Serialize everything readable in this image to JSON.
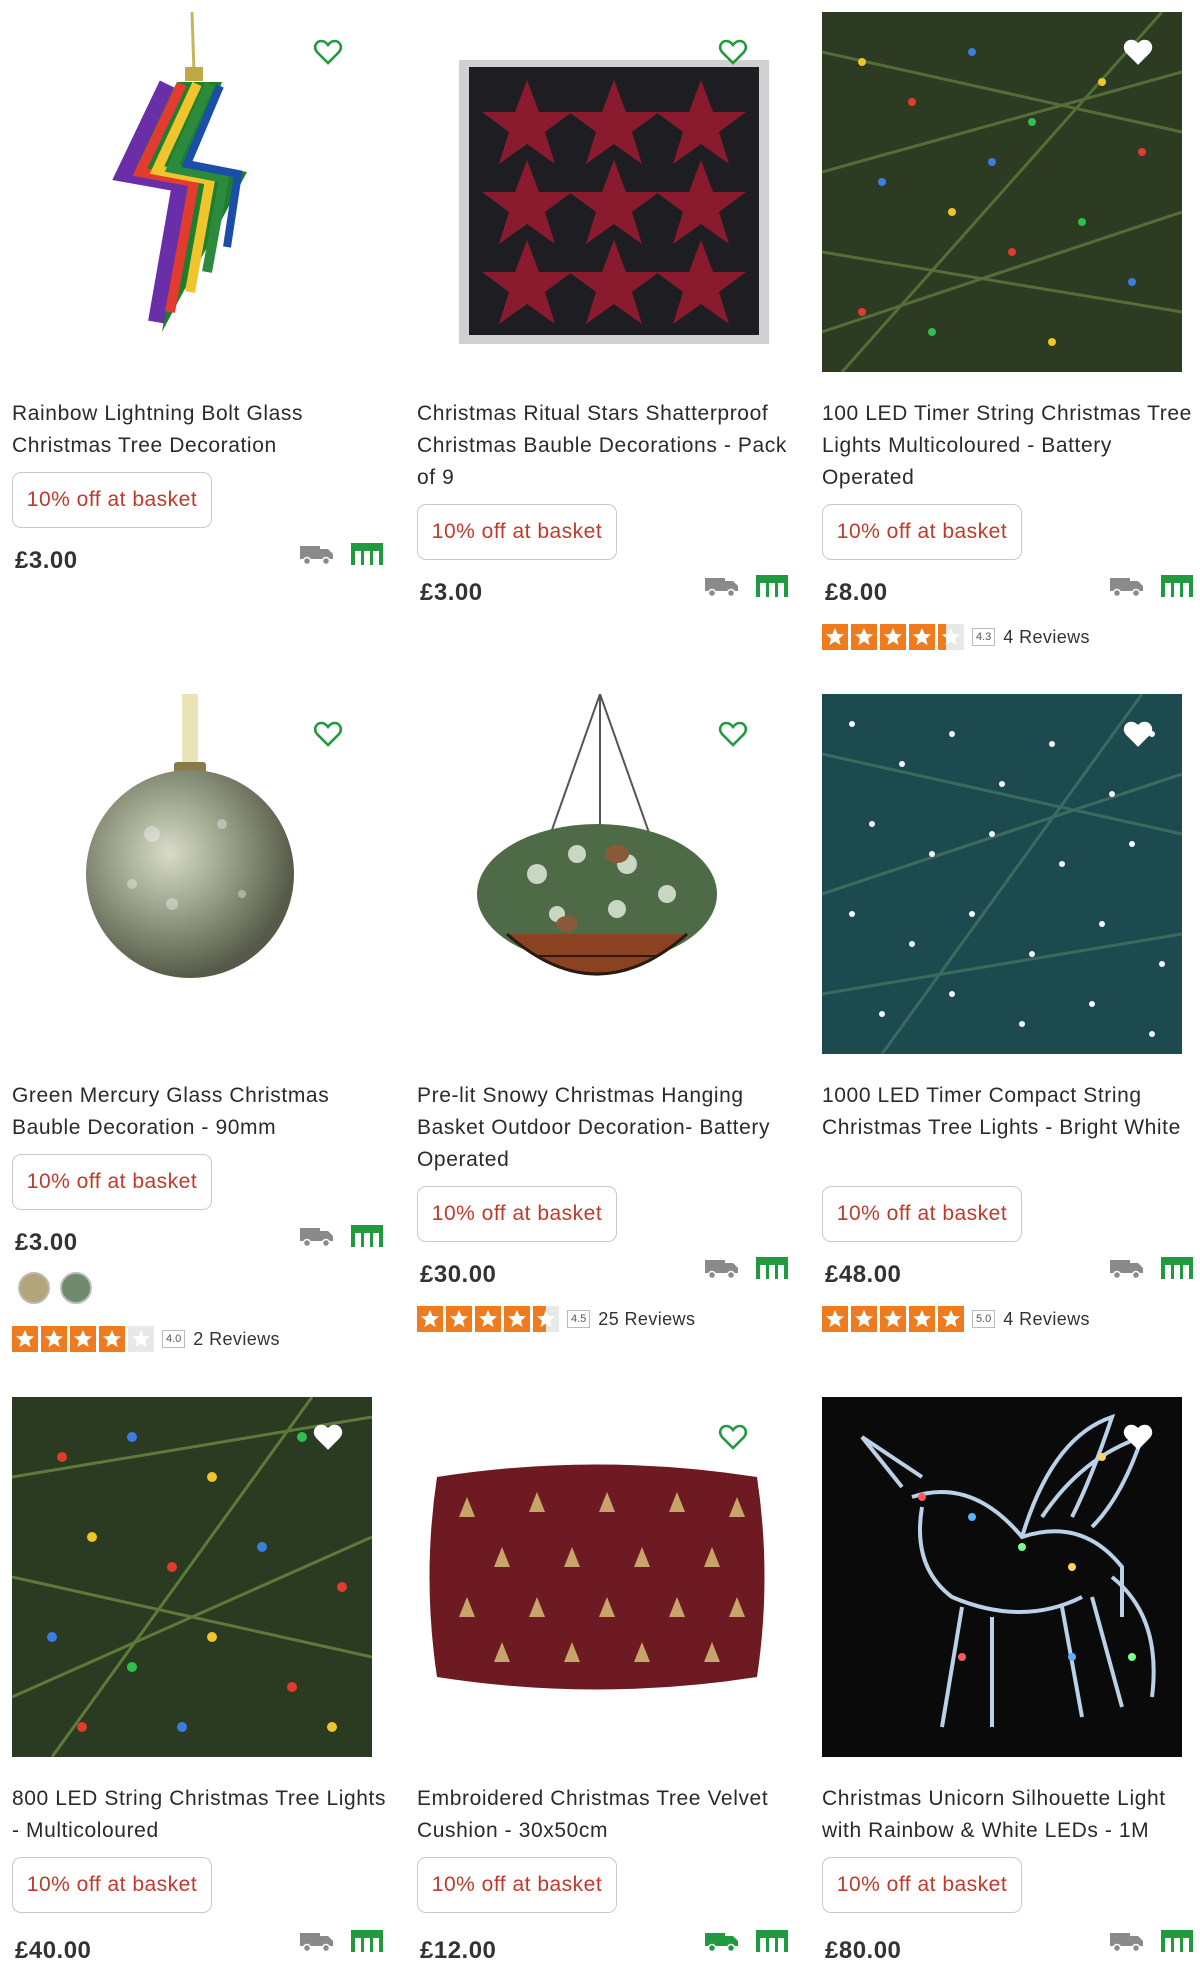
{
  "promo_label": "10% off at basket",
  "colors": {
    "promo_text": "#c0392b",
    "wishlist": "#1f9a3e",
    "store_icon": "#1f9a3e",
    "delivery_grey": "#8a8a8a",
    "star": "#ee7c1f"
  },
  "products": [
    {
      "title": "Rainbow Lightning Bolt Glass Christmas Tree Decoration",
      "price": "£3.00",
      "image": "rainbow-lightning-bolt-ornament"
    },
    {
      "title": "Christmas Ritual Stars Shatterproof Christmas Bauble Decorations - Pack of 9",
      "price": "£3.00",
      "image": "red-star-baubles-box"
    },
    {
      "title": "100 LED Timer String Christmas Tree Lights Multicoloured - Battery Operated",
      "price": "£8.00",
      "image": "multicolour-tree-lights",
      "rating": 4.3,
      "score_label": "4.3",
      "reviews": "4 Reviews"
    },
    {
      "title": "Green Mercury Glass Christmas Bauble Decoration - 90mm",
      "price": "£3.00",
      "image": "mercury-glass-bauble",
      "rating": 4.0,
      "score_label": "4.0",
      "reviews": "2 Reviews",
      "swatches": [
        "#b3a57a",
        "#6f8a6c"
      ]
    },
    {
      "title": "Pre-lit Snowy Christmas Hanging Basket Outdoor Decoration- Battery Operated",
      "price": "£30.00",
      "image": "hanging-basket",
      "rating": 4.5,
      "score_label": "4.5",
      "reviews": "25 Reviews"
    },
    {
      "title": "1000 LED Timer Compact String Christmas Tree Lights - Bright White",
      "price": "£48.00",
      "image": "white-tree-lights",
      "rating": 5.0,
      "score_label": "5.0",
      "reviews": "4 Reviews"
    },
    {
      "title": "800 LED String Christmas Tree Lights - Multicoloured",
      "price": "£40.00",
      "image": "multicolour-string-lights"
    },
    {
      "title": "Embroidered Christmas Tree Velvet Cushion - 30x50cm",
      "price": "£12.00",
      "image": "velvet-cushion",
      "delivery_available": true
    },
    {
      "title": "Christmas Unicorn Silhouette Light with Rainbow & White LEDs - 1M",
      "price": "£80.00",
      "image": "unicorn-light"
    }
  ]
}
